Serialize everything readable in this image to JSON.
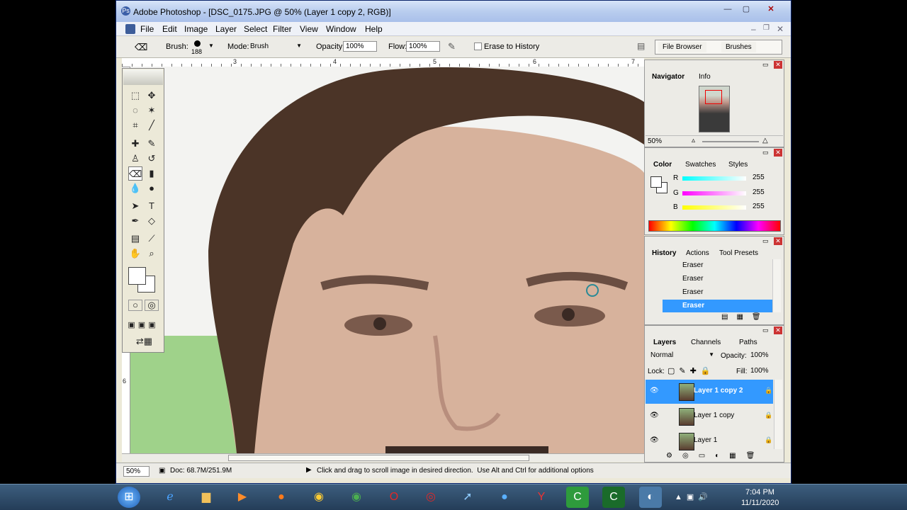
{
  "window": {
    "title": "Adobe Photoshop - [DSC_0175.JPG @ 50% (Layer 1 copy 2, RGB)]"
  },
  "menu": [
    "File",
    "Edit",
    "Image",
    "Layer",
    "Select",
    "Filter",
    "View",
    "Window",
    "Help"
  ],
  "options": {
    "brush_label": "Brush:",
    "brush_size": "188",
    "mode_label": "Mode:",
    "mode_value": "Brush",
    "opacity_label": "Opacity:",
    "opacity_value": "100%",
    "flow_label": "Flow:",
    "flow_value": "100%",
    "erase_history": "Erase to History"
  },
  "palette_well": {
    "file_browser": "File Browser",
    "brushes": "Brushes"
  },
  "rulers": {
    "h": [
      "3",
      "4",
      "5",
      "6",
      "7"
    ],
    "v": [
      "6"
    ]
  },
  "navigator": {
    "tabs": [
      "Navigator",
      "Info"
    ],
    "zoom": "50%"
  },
  "color": {
    "tabs": [
      "Color",
      "Swatches",
      "Styles"
    ],
    "r_label": "R",
    "g_label": "G",
    "b_label": "B",
    "r": "255",
    "g": "255",
    "b": "255"
  },
  "history": {
    "tabs": [
      "History",
      "Actions",
      "Tool Presets"
    ],
    "items": [
      "Eraser",
      "Eraser",
      "Eraser",
      "Eraser"
    ]
  },
  "layers": {
    "tabs": [
      "Layers",
      "Channels",
      "Paths"
    ],
    "blend": "Normal",
    "opacity_label": "Opacity:",
    "opacity": "100%",
    "lock_label": "Lock:",
    "fill_label": "Fill:",
    "fill": "100%",
    "items": [
      "Layer 1 copy 2",
      "Layer 1 copy",
      "Layer 1"
    ]
  },
  "status": {
    "zoom": "50%",
    "doc": "Doc: 68.7M/251.9M",
    "hint": "Click and drag to scroll image in desired direction.  Use Alt and Ctrl for additional options"
  },
  "taskbar": {
    "time": "7:04 PM",
    "date": "11/11/2020"
  },
  "colors": {
    "accent": "#316ac5",
    "selection": "#3399ff"
  }
}
